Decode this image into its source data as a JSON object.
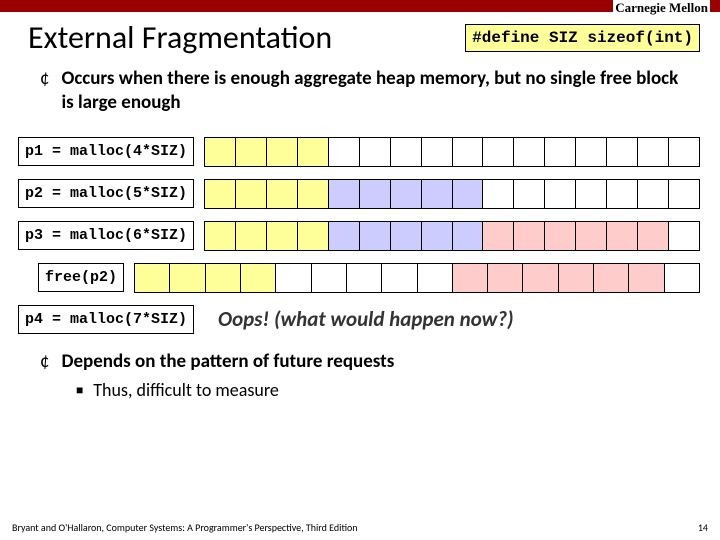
{
  "header": {
    "institution": "Carnegie Mellon"
  },
  "title": "External Fragmentation",
  "define_code": "#define SIZ sizeof(int)",
  "bullet1": "Occurs when there is enough aggregate heap memory, but no single free block is large enough",
  "rows": {
    "r1": "p1 = malloc(4*SIZ)",
    "r2": "p2 = malloc(5*SIZ)",
    "r3": "p3 = malloc(6*SIZ)",
    "r4": "free(p2)",
    "r5": "p4 = malloc(7*SIZ)"
  },
  "oops": "Oops! (what would happen now?)",
  "bullet2": "Depends on the pattern of future requests",
  "subbullet": "Thus, difficult to measure",
  "footer": {
    "left": "Bryant and O'Hallaron, Computer Systems: A Programmer's Perspective, Third Edition",
    "page": "14"
  },
  "chart_data": [
    {
      "type": "table",
      "title": "Heap after p1=malloc(4*SIZ)",
      "cells": [
        "y",
        "y",
        "y",
        "y",
        "w",
        "w",
        "w",
        "w",
        "w",
        "w",
        "w",
        "w",
        "w",
        "w",
        "w",
        "w"
      ]
    },
    {
      "type": "table",
      "title": "Heap after p2=malloc(5*SIZ)",
      "cells": [
        "y",
        "y",
        "y",
        "y",
        "b",
        "b",
        "b",
        "b",
        "b",
        "w",
        "w",
        "w",
        "w",
        "w",
        "w",
        "w"
      ]
    },
    {
      "type": "table",
      "title": "Heap after p3=malloc(6*SIZ)",
      "cells": [
        "y",
        "y",
        "y",
        "y",
        "b",
        "b",
        "b",
        "b",
        "b",
        "p",
        "p",
        "p",
        "p",
        "p",
        "p",
        "w"
      ]
    },
    {
      "type": "table",
      "title": "Heap after free(p2)",
      "cells": [
        "y",
        "y",
        "y",
        "y",
        "w",
        "w",
        "w",
        "w",
        "w",
        "p",
        "p",
        "p",
        "p",
        "p",
        "p",
        "w"
      ]
    }
  ]
}
